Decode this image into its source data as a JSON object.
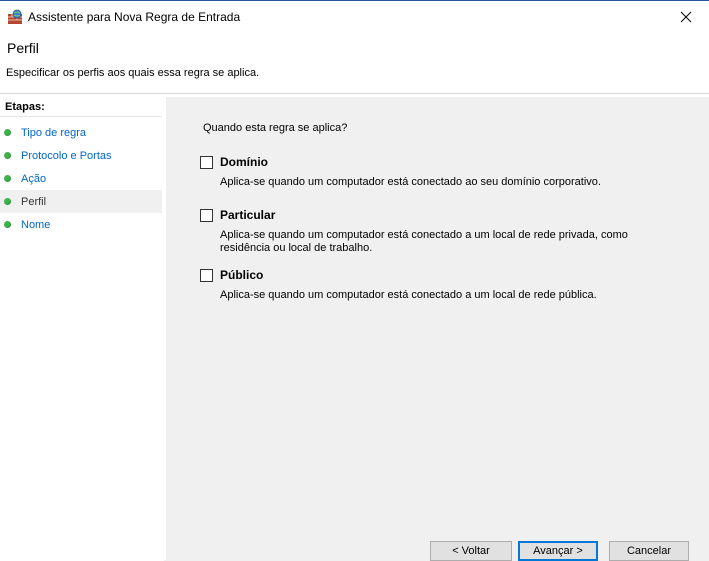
{
  "window": {
    "title": "Assistente para Nova Regra de Entrada",
    "close_glyph": "✕"
  },
  "header": {
    "title": "Perfil",
    "description": "Especificar os perfis aos quais essa regra se aplica."
  },
  "steps": {
    "heading": "Etapas:",
    "items": [
      {
        "label": "Tipo de regra",
        "current": false
      },
      {
        "label": "Protocolo e Portas",
        "current": false
      },
      {
        "label": "Ação",
        "current": false
      },
      {
        "label": "Perfil",
        "current": true
      },
      {
        "label": "Nome",
        "current": false
      }
    ]
  },
  "main": {
    "question": "Quando esta regra se aplica?",
    "options": [
      {
        "label": "Domínio",
        "checked": false,
        "description": "Aplica-se quando um computador está conectado ao seu domínio corporativo."
      },
      {
        "label": "Particular",
        "checked": false,
        "description": "Aplica-se quando um computador está conectado a um local de rede privada, como residência ou local de trabalho."
      },
      {
        "label": "Público",
        "checked": false,
        "description": "Aplica-se quando um computador está conectado a um local de rede pública."
      }
    ]
  },
  "buttons": {
    "back": "< Voltar",
    "next": "Avançar >",
    "cancel": "Cancelar"
  },
  "colors": {
    "accent": "#0078d7",
    "step_link": "#0066cc",
    "step_dot": "#3cb44a"
  }
}
